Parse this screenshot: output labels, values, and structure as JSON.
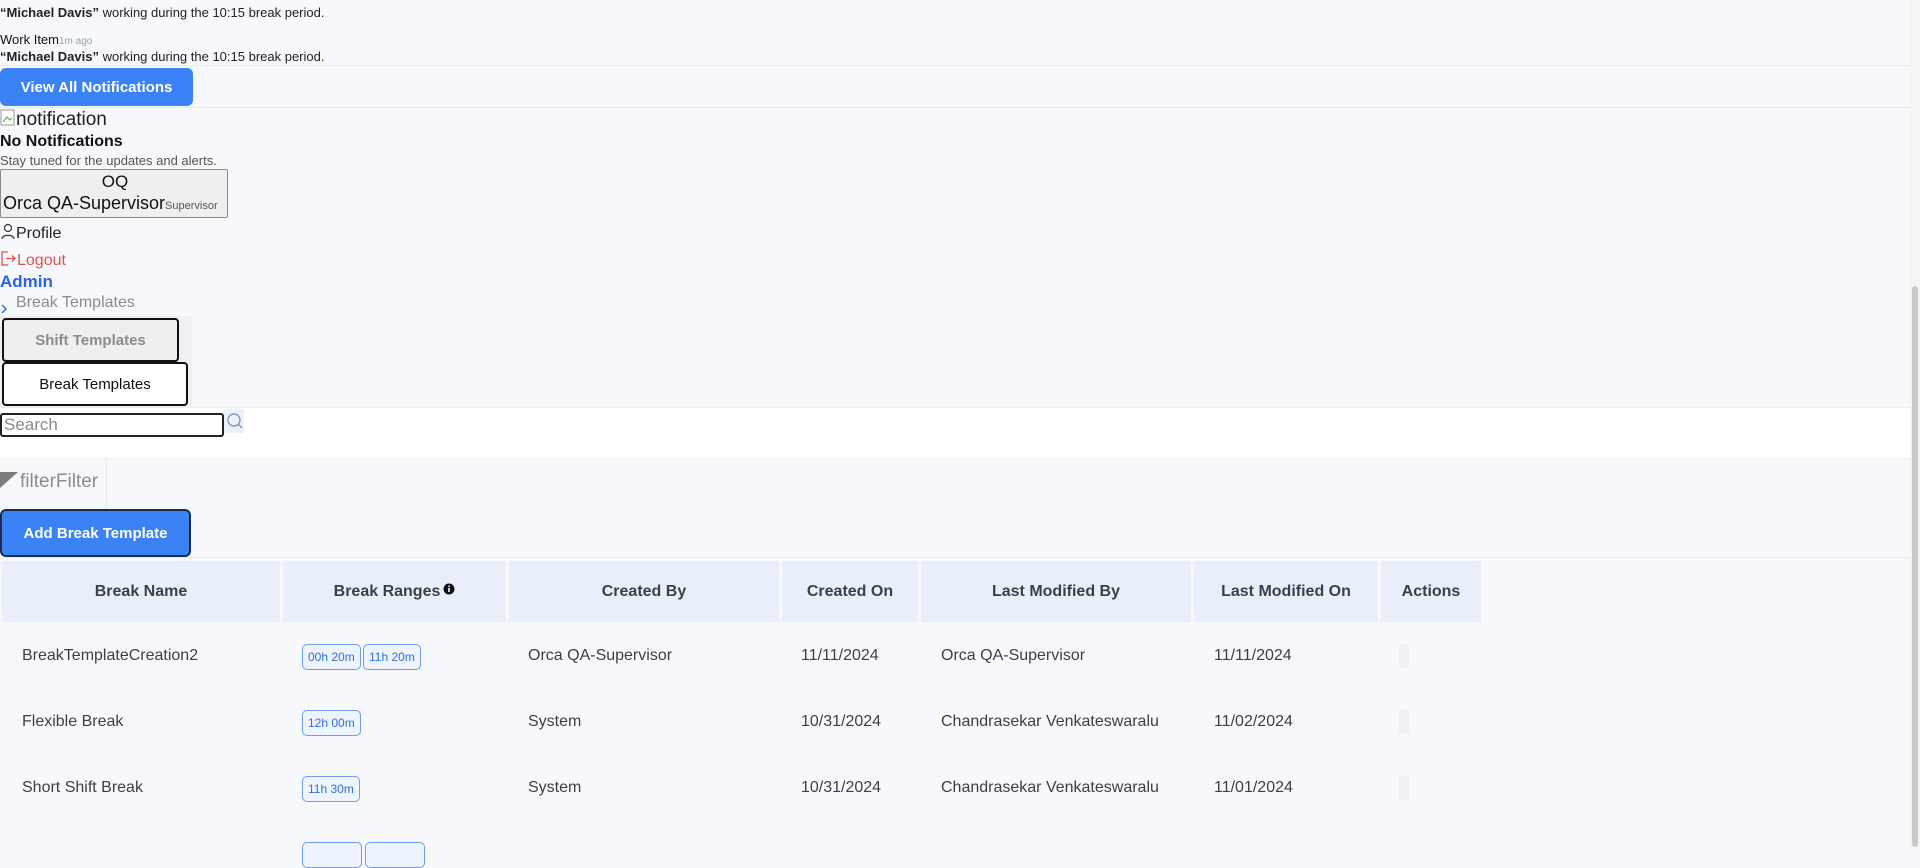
{
  "notifications": {
    "items": [
      {
        "name": "“Michael Davis”",
        "message": " working during the 10:15 break period."
      },
      {
        "title": "Work Item",
        "time": "1m ago",
        "name": "“Michael Davis”",
        "message": " working during the 10:15 break period."
      }
    ],
    "view_all_label": "View All Notifications",
    "image_alt": "notification",
    "empty_title": "No Notifications",
    "empty_subtitle": "Stay tuned for the updates and alerts."
  },
  "user": {
    "initials": "OQ",
    "name": "Orca QA-Supervisor",
    "role": "Supervisor",
    "menu": {
      "profile": "Profile",
      "logout": "Logout"
    }
  },
  "breadcrumb": {
    "root": "Admin",
    "current": "Break Templates"
  },
  "tabs": [
    {
      "label": "Shift Templates",
      "active": false
    },
    {
      "label": "Break Templates",
      "active": true
    }
  ],
  "search": {
    "placeholder": "Search"
  },
  "filter": {
    "label": "filterFilter"
  },
  "add_button_label": "Add Break Template",
  "table": {
    "headers": {
      "break_name": "Break Name",
      "break_ranges": "Break Ranges",
      "created_by": "Created By",
      "created_on": "Created On",
      "last_modified_by": "Last Modified By",
      "last_modified_on": "Last Modified On",
      "actions": "Actions"
    },
    "rows": [
      {
        "name": "BreakTemplateCreation2",
        "ranges": [
          "00h 20m",
          "11h 20m"
        ],
        "created_by": "Orca QA-Supervisor",
        "created_on": "11/11/2024",
        "modified_by": "Orca QA-Supervisor",
        "modified_on": "11/11/2024"
      },
      {
        "name": "Flexible Break",
        "ranges": [
          "12h 00m"
        ],
        "created_by": "System",
        "created_on": "10/31/2024",
        "modified_by": "Chandrasekar Venkateswaralu",
        "modified_on": "11/02/2024"
      },
      {
        "name": "Short Shift Break",
        "ranges": [
          "11h 30m"
        ],
        "created_by": "System",
        "created_on": "10/31/2024",
        "modified_by": "Chandrasekar Venkateswaralu",
        "modified_on": "11/01/2024"
      }
    ]
  },
  "colors": {
    "primary": "#3b82f6",
    "logout": "#e05252",
    "link": "#2563eb",
    "header_bg": "#e9effa",
    "chip_border": "#6d9cf0"
  }
}
